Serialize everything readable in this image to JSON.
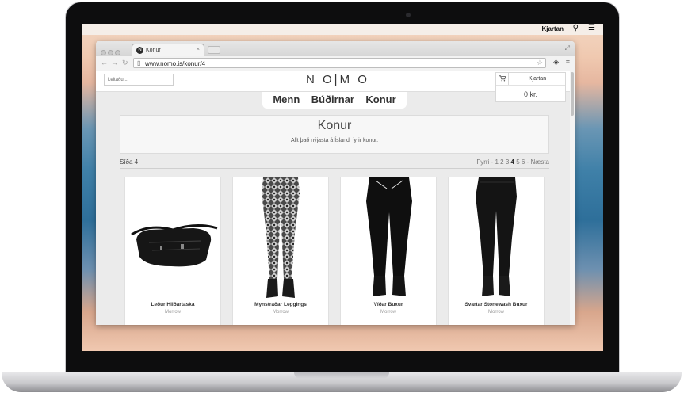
{
  "menubar": {
    "user": "Kjartan"
  },
  "browser": {
    "tab_title": "Konur",
    "favicon_letter": "N",
    "url": "www.nomo.is/konur/4"
  },
  "site": {
    "search_placeholder": "Leitaðu...",
    "logo": "N O|M O",
    "cart": {
      "user": "Kjartan",
      "total": "0 kr."
    },
    "nav": [
      "Menn",
      "Búðirnar",
      "Konur"
    ],
    "hero": {
      "title": "Konur",
      "subtitle": "Allt það nýjasta á Íslandi fyrir konur."
    },
    "page_label": "Síða 4",
    "pagination": {
      "prev": "Fyrri",
      "pages": [
        "1",
        "2",
        "3",
        "4",
        "5",
        "6"
      ],
      "current": "4",
      "next": "Næsta"
    },
    "products": [
      {
        "name": "Leður Hliðartaska",
        "brand": "Morrow"
      },
      {
        "name": "Mynstraðar Leggings",
        "brand": "Morrow"
      },
      {
        "name": "Víðar Buxur",
        "brand": "Morrow"
      },
      {
        "name": "Svartar Stonewash Buxur",
        "brand": "Morrow"
      }
    ]
  },
  "colors": {
    "page_bg": "#ebebeb",
    "text": "#333333",
    "accent": "#222222"
  }
}
